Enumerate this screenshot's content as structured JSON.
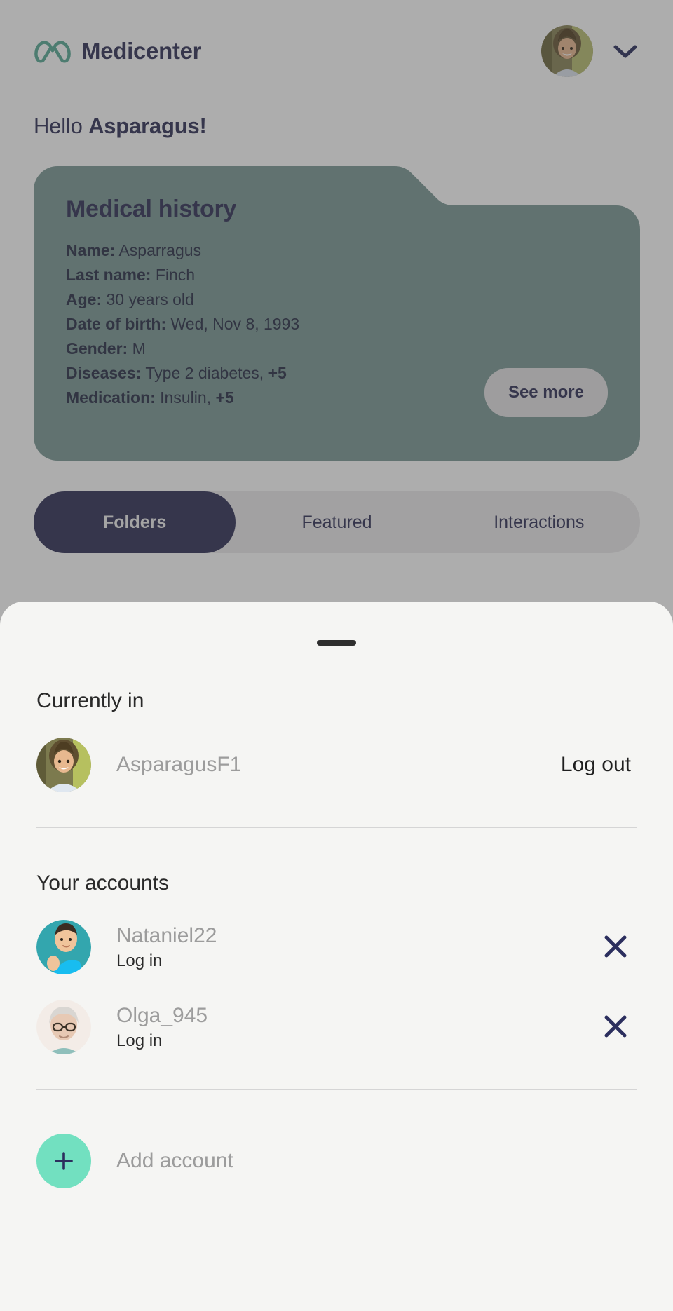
{
  "colors": {
    "brand_navy": "#323359",
    "brand_teal": "#5aab97",
    "card_teal": "#7d9a96",
    "mint": "#72e0c0",
    "sheet_bg": "#f5f5f3",
    "muted_text": "#9c9c9c",
    "scrim": "rgba(60,60,60,0.42)"
  },
  "header": {
    "logo_icon": "medicenter-loops-logo",
    "brand_name": "Medicenter",
    "avatar_icon": "user-avatar",
    "chevron_icon": "chevron-down-icon"
  },
  "greeting": {
    "prefix": "Hello ",
    "name": "Asparagus!"
  },
  "medical_history": {
    "title": "Medical history",
    "fields": [
      {
        "key": "Name:",
        "value": "Asparragus"
      },
      {
        "key": "Last name:",
        "value": "Finch"
      },
      {
        "key": "Age:",
        "value": "30 years old"
      },
      {
        "key": "Date of birth:",
        "value": "Wed, Nov 8, 1993"
      },
      {
        "key": "Gender:",
        "value": "M"
      },
      {
        "key": "Diseases:",
        "value": "Type 2 diabetes, ",
        "extra": "+5"
      },
      {
        "key": "Medication:",
        "value": "Insulin, ",
        "extra": "+5"
      }
    ],
    "see_more_label": "See more"
  },
  "tabs": [
    {
      "label": "Folders",
      "active": true
    },
    {
      "label": "Featured",
      "active": false
    },
    {
      "label": "Interactions",
      "active": false
    }
  ],
  "sheet": {
    "handle_icon": "drag-handle",
    "currently_in": {
      "title": "Currently in",
      "account": {
        "avatar_icon": "avatar-asparagus",
        "name": "AsparagusF1",
        "action_label": "Log out"
      }
    },
    "your_accounts": {
      "title": "Your accounts",
      "items": [
        {
          "avatar_icon": "avatar-nataniel",
          "name": "Nataniel22",
          "action_label": "Log in",
          "remove_icon": "close-icon"
        },
        {
          "avatar_icon": "avatar-olga",
          "name": "Olga_945",
          "action_label": "Log in",
          "remove_icon": "close-icon"
        }
      ]
    },
    "add_account": {
      "icon": "plus-icon",
      "label": "Add account"
    }
  }
}
